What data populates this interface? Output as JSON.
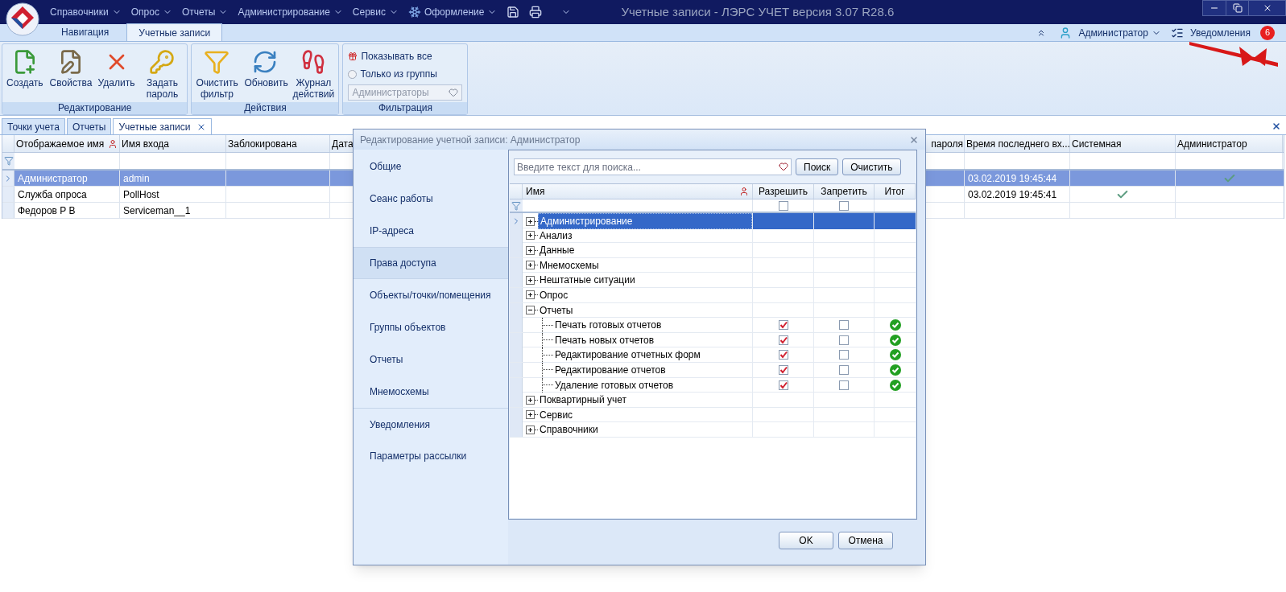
{
  "window": {
    "title": "Учетные записи - ЛЭРС УЧЕТ версия 3.07 R28.6"
  },
  "menu": [
    {
      "label": "Справочники",
      "kind": "plain"
    },
    {
      "label": "Опрос",
      "kind": "plain"
    },
    {
      "label": "Отчеты",
      "kind": "plain"
    },
    {
      "label": "Администрирование",
      "kind": "plain"
    },
    {
      "label": "Сервис",
      "kind": "plain"
    },
    {
      "label": "Оформление",
      "kind": "snowflake"
    }
  ],
  "ribbon_tabs": [
    {
      "label": "Навигация",
      "selected": false
    },
    {
      "label": "Учетные записи",
      "selected": true
    }
  ],
  "user": {
    "name": "Администратор"
  },
  "notifications": {
    "label": "Уведомления",
    "count": "6"
  },
  "ribbon_groups": [
    {
      "title": "Редактирование",
      "kind": "buttons",
      "buttons": [
        "Создать",
        "Свойства",
        "Удалить",
        "Задать пароль"
      ]
    },
    {
      "title": "Действия",
      "kind": "buttons",
      "buttons": [
        "Очистить фильтр",
        "Обновить",
        "Журнал действий"
      ]
    },
    {
      "title": "Фильтрация",
      "kind": "filter",
      "options": [
        {
          "label": "Показывать все",
          "selected": true
        },
        {
          "label": "Только из группы",
          "selected": false
        }
      ],
      "group_select": {
        "value": "Администраторы",
        "disabled": true
      }
    }
  ],
  "document_tabs": [
    {
      "label": "Точки учета",
      "selected": false,
      "closable": false
    },
    {
      "label": "Отчеты",
      "selected": false,
      "closable": false
    },
    {
      "label": "Учетные записи",
      "selected": true,
      "closable": true
    }
  ],
  "accounts_table": {
    "columns": [
      "Отображаемое имя",
      "Имя входа",
      "Заблокирована",
      "Дата",
      "пароля",
      "Время последнего вх...",
      "Системная",
      "Администратор"
    ],
    "rows": [
      {
        "display_name": "Администратор",
        "login": "admin",
        "last_login": "03.02.2019 19:45:44",
        "system": false,
        "admin": true,
        "selected": true
      },
      {
        "display_name": "Служба опроса",
        "login": "PollHost",
        "last_login": "03.02.2019 19:45:41",
        "system": true,
        "admin": false,
        "selected": false
      },
      {
        "display_name": "Федоров Р В",
        "login": "Serviceman__1",
        "system": false,
        "admin": false,
        "selected": false
      }
    ]
  },
  "dialog": {
    "title": "Редактирование учетной записи: Администратор",
    "nav": [
      {
        "label": "Общие",
        "selected": false
      },
      {
        "label": "Сеанс работы",
        "selected": false
      },
      {
        "label": "IP-адреса",
        "selected": false
      },
      {
        "label": "Права доступа",
        "selected": true
      },
      {
        "label": "Объекты/точки/помещения",
        "selected": false
      },
      {
        "label": "Группы объектов",
        "selected": false
      },
      {
        "label": "Отчеты",
        "selected": false
      },
      {
        "label": "Мнемосхемы",
        "selected": false
      },
      {
        "label": "Уведомления",
        "selected": false
      },
      {
        "label": "Параметры рассылки",
        "selected": false
      }
    ],
    "search": {
      "placeholder": "Введите текст для поиска..."
    },
    "search_buttons": [
      "Поиск",
      "Очистить"
    ],
    "tree": {
      "columns": [
        "Имя",
        "Разрешить",
        "Запретить",
        "Итог"
      ],
      "filter": {
        "allow": false,
        "deny": false
      },
      "rows": [
        {
          "label": "Администрирование",
          "expanded": false,
          "selected": true
        },
        {
          "label": "Анализ",
          "expanded": false,
          "selected": false
        },
        {
          "label": "Данные",
          "expanded": false,
          "selected": false
        },
        {
          "label": "Мнемосхемы",
          "expanded": false,
          "selected": false
        },
        {
          "label": "Нештатные ситуации",
          "expanded": false,
          "selected": false
        },
        {
          "label": "Опрос",
          "expanded": false,
          "selected": false
        },
        {
          "label": "Отчеты",
          "expanded": true,
          "selected": false,
          "children": [
            {
              "label": "Печать готовых отчетов",
              "allow": true,
              "deny": false,
              "result": true,
              "selected": false
            },
            {
              "label": "Печать новых отчетов",
              "allow": true,
              "deny": false,
              "result": true,
              "selected": false
            },
            {
              "label": "Редактирование отчетных форм",
              "allow": true,
              "deny": false,
              "result": true,
              "selected": false
            },
            {
              "label": "Редактирование отчетов",
              "allow": true,
              "deny": false,
              "result": true,
              "selected": false
            },
            {
              "label": "Удаление готовых отчетов",
              "allow": true,
              "deny": false,
              "result": true,
              "selected": false
            }
          ]
        },
        {
          "label": "Поквартирный учет",
          "expanded": false,
          "selected": false
        },
        {
          "label": "Сервис",
          "expanded": false,
          "selected": false
        },
        {
          "label": "Справочники",
          "expanded": false,
          "selected": false
        }
      ]
    },
    "footer_buttons": [
      "OK",
      "Отмена"
    ]
  }
}
